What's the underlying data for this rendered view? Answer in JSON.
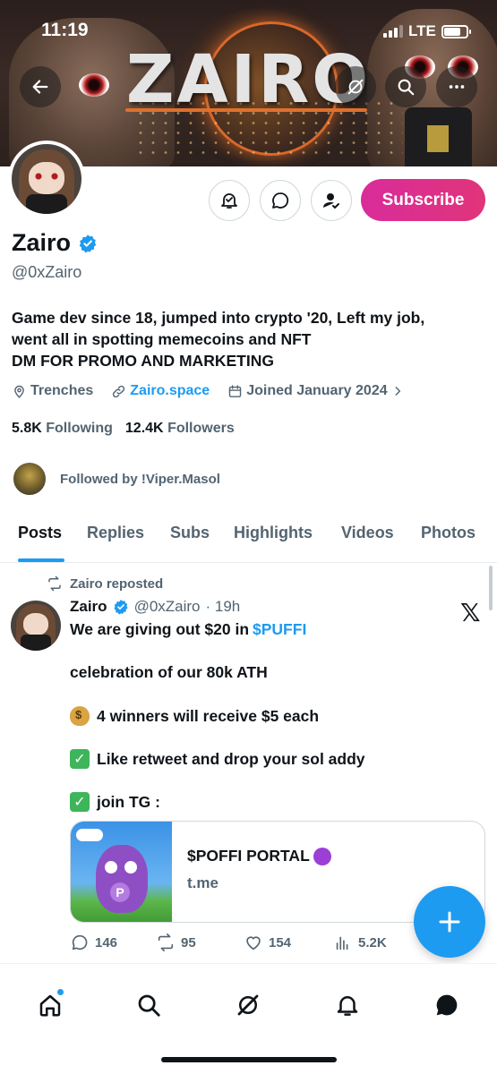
{
  "status_bar": {
    "time": "11:19",
    "network": "LTE",
    "signal_bars": 3,
    "battery_level": 0.75
  },
  "header": {
    "banner_title": "ZAIRO",
    "icons": [
      "back-arrow-icon",
      "grok-icon",
      "search-icon",
      "more-icon"
    ]
  },
  "profile": {
    "display_name": "Zairo",
    "handle": "@0xZairo",
    "verified": true,
    "subscribe_label": "Subscribe",
    "bio_lines": [
      "Game dev since 18, jumped into crypto '20, Left my job,",
      "went all in spotting memecoins and NFT",
      "DM FOR PROMO AND MARKETING"
    ],
    "location": "Trenches",
    "website": "Zairo.space",
    "joined": "Joined January 2024",
    "following_count": "5.8K",
    "following_label": "Following",
    "followers_count": "12.4K",
    "followers_label": "Followers",
    "followed_by": "Followed by !Viper.Masol"
  },
  "tabs": [
    {
      "label": "Posts",
      "active": true
    },
    {
      "label": "Replies",
      "active": false
    },
    {
      "label": "Subs",
      "active": false
    },
    {
      "label": "Highlights",
      "active": false
    },
    {
      "label": "Videos",
      "active": false
    },
    {
      "label": "Photos",
      "active": false
    }
  ],
  "post": {
    "repost_text": "Zairo reposted",
    "author_name": "Zairo",
    "author_handle": "@0xZairo",
    "time": "· 19h",
    "line1_prefix": "We are giving out $20 in",
    "line1_cashtag": "$PUFFI",
    "line2": "celebration of our 80k ATH",
    "line3": "4 winners will receive $5 each",
    "line4": "Like retweet and  drop your sol addy",
    "line5": "join TG :",
    "card_title": "$POFFI PORTAL",
    "card_domain": "t.me",
    "replies": "146",
    "reposts": "95",
    "likes": "154",
    "views": "5.2K"
  },
  "colors": {
    "accent": "#1d9bf0",
    "subscribe": "#d92c9a",
    "muted_text": "#536471"
  }
}
